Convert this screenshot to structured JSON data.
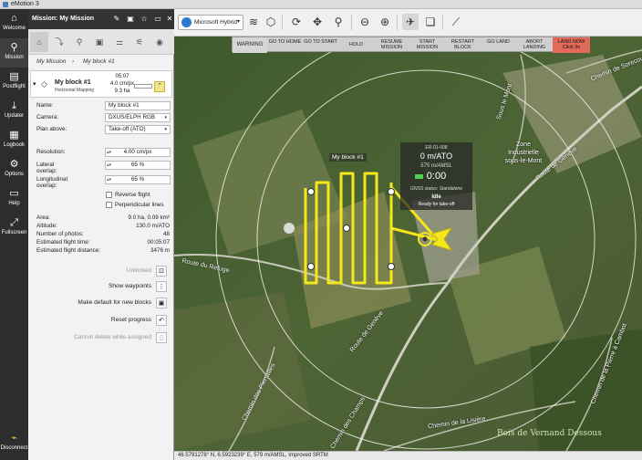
{
  "window": {
    "title": "eMotion 3"
  },
  "nav": [
    {
      "label": "Welcome",
      "icon": "home-icon"
    },
    {
      "label": "Mission",
      "icon": "waypoints-icon"
    },
    {
      "label": "Postflight",
      "icon": "document-icon"
    },
    {
      "label": "Updater",
      "icon": "download-icon"
    },
    {
      "label": "Logbook",
      "icon": "logbook-icon"
    },
    {
      "label": "Options",
      "icon": "gear-icon"
    },
    {
      "label": "Help",
      "icon": "book-icon"
    },
    {
      "label": "Fullscreen",
      "icon": "fullscreen-icon"
    },
    {
      "label": "Disconnect",
      "icon": "connection-icon"
    }
  ],
  "panel": {
    "title": "Mission: My Mission",
    "breadcrumb": [
      "My Mission",
      "My block #1"
    ],
    "block": {
      "name": "My block #1",
      "type": "Horizontal Mapping",
      "time": "05:07",
      "gsd": "4.0 cm/px",
      "area": "9.3 ha"
    },
    "fields": {
      "name_label": "Name:",
      "name_value": "My block #1",
      "camera_label": "Camera:",
      "camera_value": "DXUS/ELPH RGB",
      "plan_label": "Plan above:",
      "plan_value": "Take-off (ATO)",
      "resolution_label": "Resolution:",
      "resolution_value": "4.00 cm/px",
      "lateral_label": "Lateral overlap:",
      "lateral_value": "65 %",
      "longitudinal_label": "Longitudinal overlap:",
      "longitudinal_value": "65 %"
    },
    "checks": {
      "reverse": "Reverse flight",
      "perpendicular": "Perpendicular lines"
    },
    "stats": [
      {
        "label": "Area:",
        "value": "9.0 ha, 0.09 km²"
      },
      {
        "label": "Altitude:",
        "value": "130.0 m/ATO"
      },
      {
        "label": "Number of photos:",
        "value": "48"
      },
      {
        "label": "Estimated flight time:",
        "value": "00:05:07"
      },
      {
        "label": "Estimated flight distance:",
        "value": "3476 m"
      }
    ],
    "actions": {
      "unlocked": "Unlocked",
      "show_waypoints": "Show waypoints",
      "make_default": "Make default for new blocks",
      "reset_progress": "Reset progress",
      "cannot_delete": "Cannot delete while assigned"
    }
  },
  "toolbar": {
    "map_source": "Microsoft Hybrid"
  },
  "commands": [
    {
      "label": "WARNING",
      "type": "warn"
    },
    {
      "label": "GO TO HOME",
      "type": "normal"
    },
    {
      "label": "GO TO START",
      "type": "normal"
    },
    {
      "label": "HOLD",
      "type": "normal"
    },
    {
      "label": "RESUME MISSION",
      "type": "normal"
    },
    {
      "label": "START MISSION",
      "type": "normal"
    },
    {
      "label": "RESTART BLOCK",
      "type": "normal"
    },
    {
      "label": "GO LAND",
      "type": "normal"
    },
    {
      "label": "ABORT LANDING",
      "type": "normal"
    },
    {
      "label": "LAND NOW Click 3x",
      "type": "land"
    }
  ],
  "telemetry": {
    "id": "ER-01-008",
    "altitude": "0 m/ATO",
    "amsl": "575 m/AMSL",
    "time": "0:00",
    "gnss": "GNSS status: Standalone",
    "state": "Idle",
    "ready": "Ready for take-off"
  },
  "map": {
    "block_label": "My block #1",
    "labels": {
      "chemin_sorecou": "Chemin de Sorecou",
      "sous_le_mont": "Sous le Mont",
      "zone_industrielle": "Zone Industrielle sous-le-Mont",
      "route_geneve_ne": "Route de Genève",
      "route_refuge": "Route du Refuge",
      "route_geneve_sw": "Route de Genève",
      "chemin_pierrailles": "Chemin des Pierrailles",
      "chemin_liziere": "Chemin de la Lisière",
      "chemin_champs": "Chemin des Champs",
      "chemin_pierre": "Chemin de la Pierre à Cambot",
      "bois": "Bois de Vernand Dessous"
    }
  },
  "statusbar": {
    "coords": "46.5791278° N, 6.5923239° E, 579 m/AMSL, Improved SRTM"
  }
}
